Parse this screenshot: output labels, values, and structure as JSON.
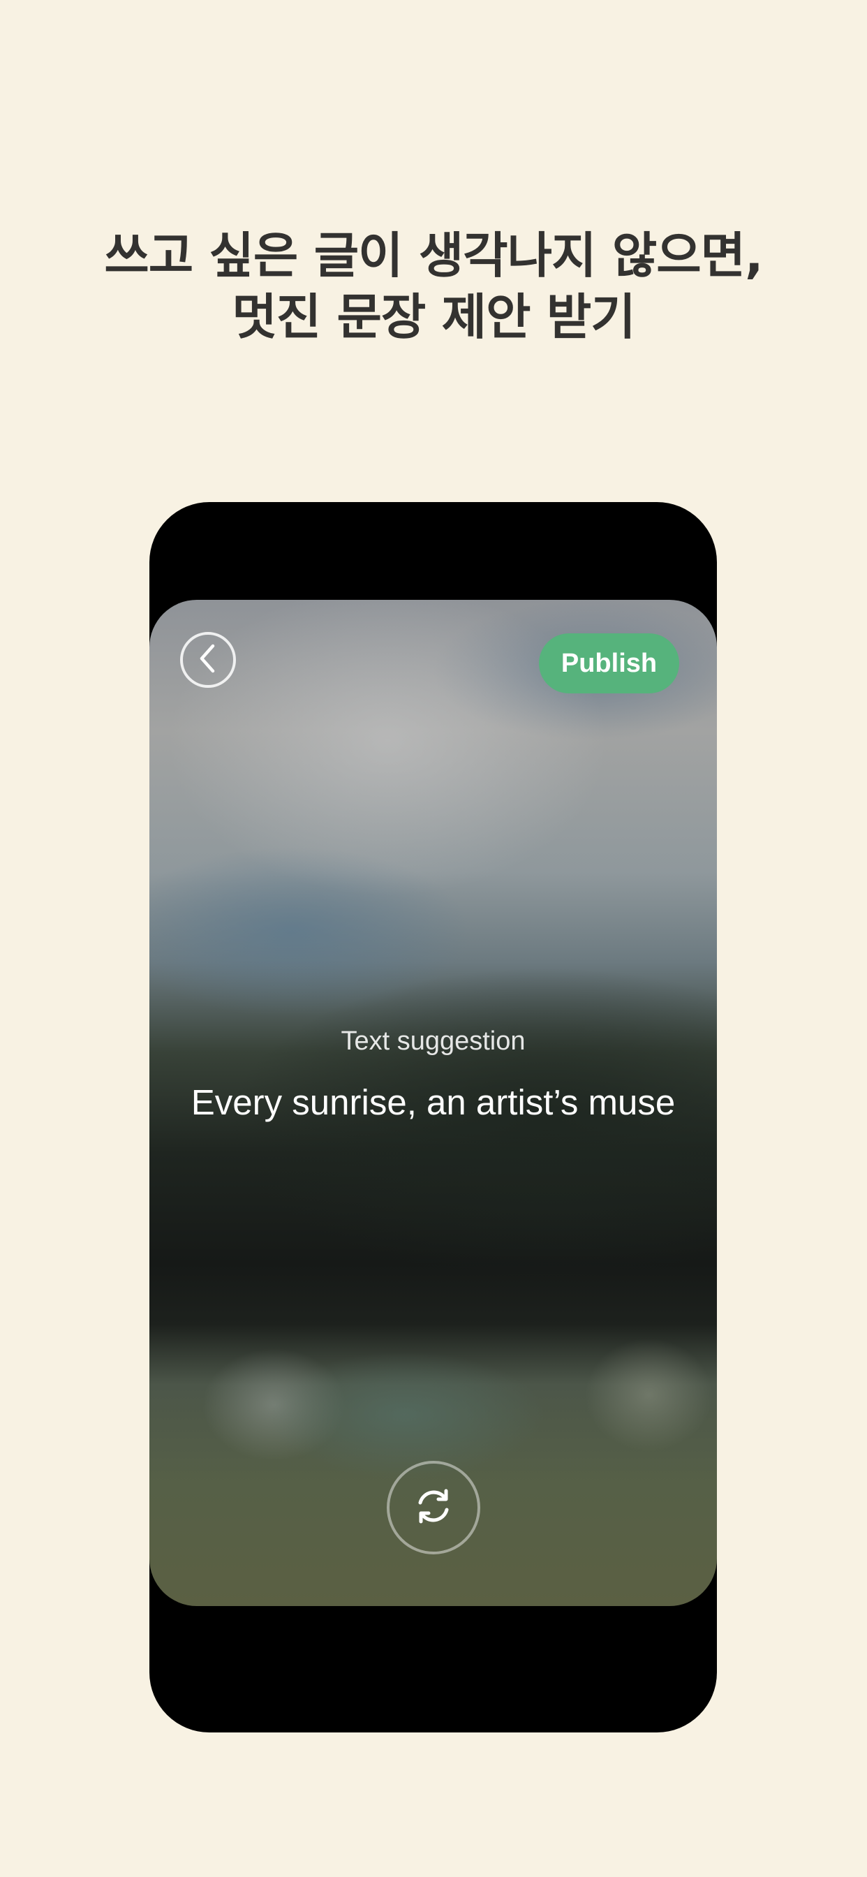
{
  "headline": {
    "line1": "쓰고 싶은 글이 생각나지 않으면,",
    "line2": "멋진 문장 제안 받기"
  },
  "editor": {
    "back_icon": "chevron-left-icon",
    "publish_label": "Publish",
    "suggestion_label": "Text suggestion",
    "suggestion_text": "Every sunrise, an artist’s muse",
    "refresh_icon": "refresh-icon"
  },
  "colors": {
    "background": "#f8f2e3",
    "headline": "#333230",
    "publish_button": "#56b37c",
    "phone_frame": "#000000"
  }
}
